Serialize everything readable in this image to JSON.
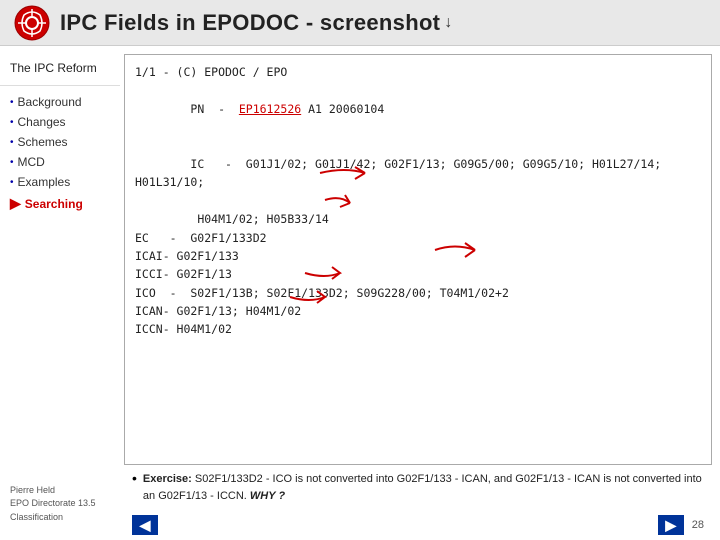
{
  "header": {
    "title": "IPC Fields in EPODOC - screenshot"
  },
  "sidebar": {
    "top_label": "The IPC Reform",
    "items": [
      {
        "label": "Background",
        "active": false
      },
      {
        "label": "Changes",
        "active": false
      },
      {
        "label": "Schemes",
        "active": false
      },
      {
        "label": "MCD",
        "active": false
      },
      {
        "label": "Examples",
        "active": false
      },
      {
        "label": "Searching",
        "active": true
      }
    ],
    "footer_lines": [
      "Pierre Held",
      "EPO Directorate 13.5",
      "Classification"
    ]
  },
  "content": {
    "page_ref": "1/1 - (C) EPODOC / EPO",
    "pn_line": "PN  -  EP1612526 A1 20060104",
    "ic_line": "IC   -  G01J1/02; G01J1/42; G02F1/13; G09G5/00; G09G5/10; H01L27/14; H01L31/10;",
    "ic_continuation": "         H04M1/02; H05B33/14",
    "ec_line": "EC   -  G02F1/133D2",
    "icai_line": "ICAI- G02F1/133",
    "icci_line": "ICCI- G02F1/13",
    "ico_line": "ICO  -  S02F1/13B; S02F1/133D2; S09G228/00; T04M1/02+2",
    "ican_line": "ICAN- G02F1/13; H04M1/02",
    "iccn_line": "ICCN- H04M1/02"
  },
  "exercise": {
    "label": "Exercise:",
    "text": "S02F1/133D2 - ICO is not converted into G02F1/133 - ICAN, and G02F1/13 - ICAN is not converted into an G02F1/13 - ICCN. WHY ?"
  },
  "nav": {
    "prev_label": "◀",
    "next_label": "▶",
    "page_number": "28"
  }
}
